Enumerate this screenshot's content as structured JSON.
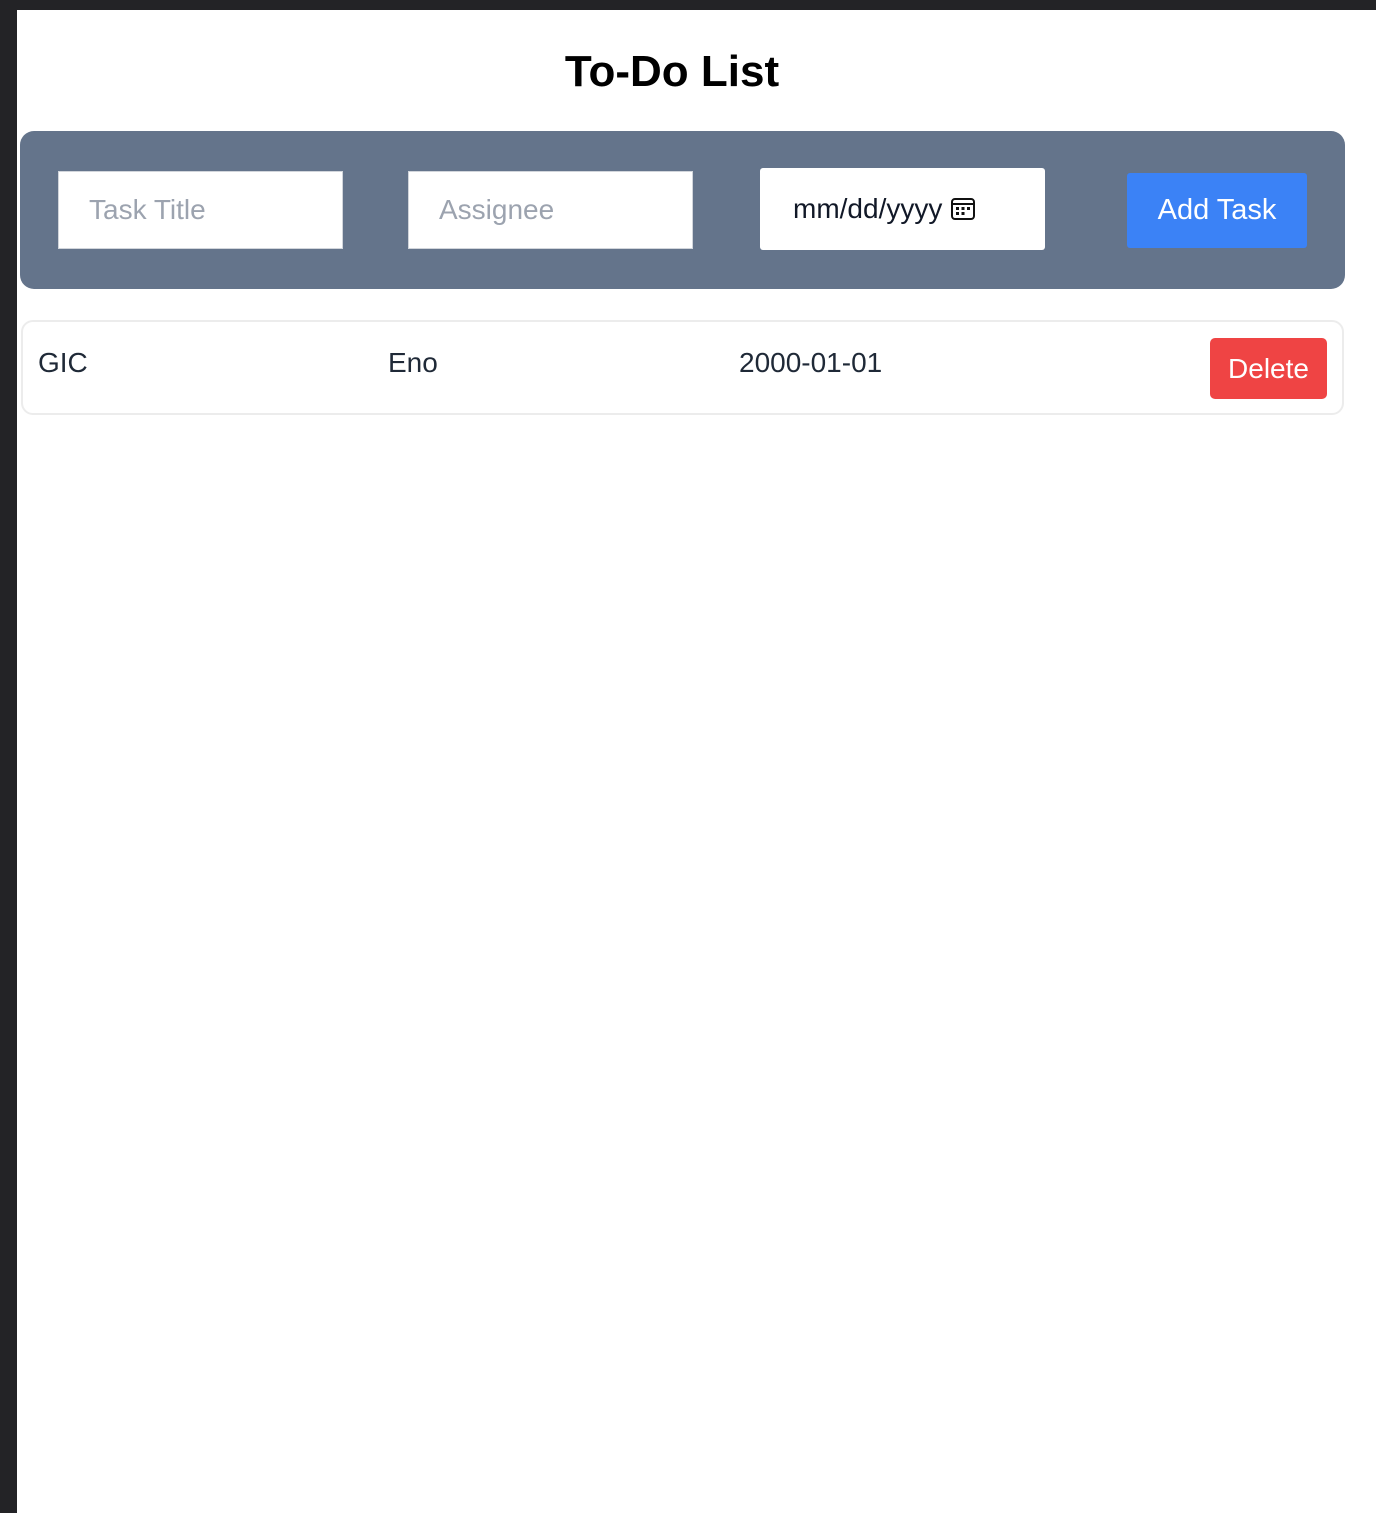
{
  "header": {
    "title": "To-Do List"
  },
  "form": {
    "title_placeholder": "Task Title",
    "assignee_placeholder": "Assignee",
    "date_placeholder": "mm/dd/yyyy",
    "add_label": "Add Task",
    "calendar_icon": "calendar-icon"
  },
  "tasks": [
    {
      "title": "GIC",
      "assignee": "Eno",
      "date": "2000-01-01",
      "delete_label": "Delete"
    }
  ],
  "colors": {
    "panel": "#64748b",
    "add_button": "#3b82f6",
    "delete_button": "#ef4444",
    "frame": "#232326"
  }
}
